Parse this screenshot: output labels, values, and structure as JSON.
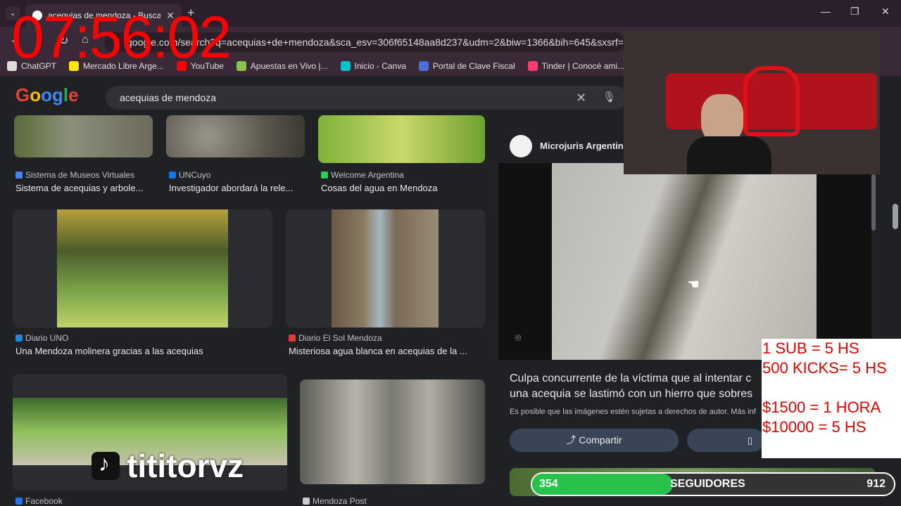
{
  "timer": "07:56:02",
  "browser": {
    "tab_title": "acequias de mendoza - Buscar",
    "url": "google.com/search?q=acequias+de+mendoza&sca_esv=306f65148aa8d237&udm=2&biw=1366&bih=645&sxsrf=ANbL-",
    "bookmarks": [
      {
        "label": "ChatGPT",
        "color": "#dddddd"
      },
      {
        "label": "Mercado Libre Arge...",
        "color": "#ffe600"
      },
      {
        "label": "YouTube",
        "color": "#ff0000"
      },
      {
        "label": "Apuestas en Vivo |...",
        "color": "#8bc34a"
      },
      {
        "label": "Inicio - Canva",
        "color": "#00c4cc"
      },
      {
        "label": "Portal de Clave Fiscal",
        "color": "#4a6fd8"
      },
      {
        "label": "Tinder | Conocé ami...",
        "color": "#fe3c72"
      }
    ]
  },
  "google": {
    "logo_text": "Google",
    "query": "acequias de mendoza"
  },
  "results": [
    {
      "source": "Sistema de Museos Virtuales",
      "title": "Sistema de acequias y arbole...",
      "src_color": "#4285f4"
    },
    {
      "source": "UNCuyo",
      "title": "Investigador abordará la rele...",
      "src_color": "#1a73e8"
    },
    {
      "source": "Welcome Argentina",
      "title": "Cosas del agua en Mendoza",
      "src_color": "#34c759"
    },
    {
      "source": "Diario UNO",
      "title": "Una Mendoza molinera gracias a las acequias",
      "src_color": "#1e88e5"
    },
    {
      "source": "Diario El Sol Mendoza",
      "title": "Misteriosa agua blanca en acequias de la ...",
      "src_color": "#e53935"
    },
    {
      "source": "Facebook",
      "title": "",
      "src_color": "#1877f2"
    },
    {
      "source": "Mendoza Post",
      "title": "",
      "src_color": "#cccccc"
    }
  ],
  "panel": {
    "source": "Microjuris Argentina",
    "title": "Culpa concurrente de la víctima que al intentar c una acequia se lastimó con un hierro que sobres",
    "note": "Es posible que las imágenes estén sujetas a derechos de autor. Más inf",
    "share_label": "Compartir"
  },
  "overlays": {
    "donations": [
      "1 SUB = 5 HS",
      "500 KICKS= 5 HS",
      "",
      "$1500 = 1 HORA",
      "$10000 = 5 HS"
    ],
    "followers_current": "354",
    "followers_label": "SEGUIDORES",
    "followers_goal": "912",
    "followers_progress": 0.39,
    "tiktok_handle": "tititorvz"
  }
}
